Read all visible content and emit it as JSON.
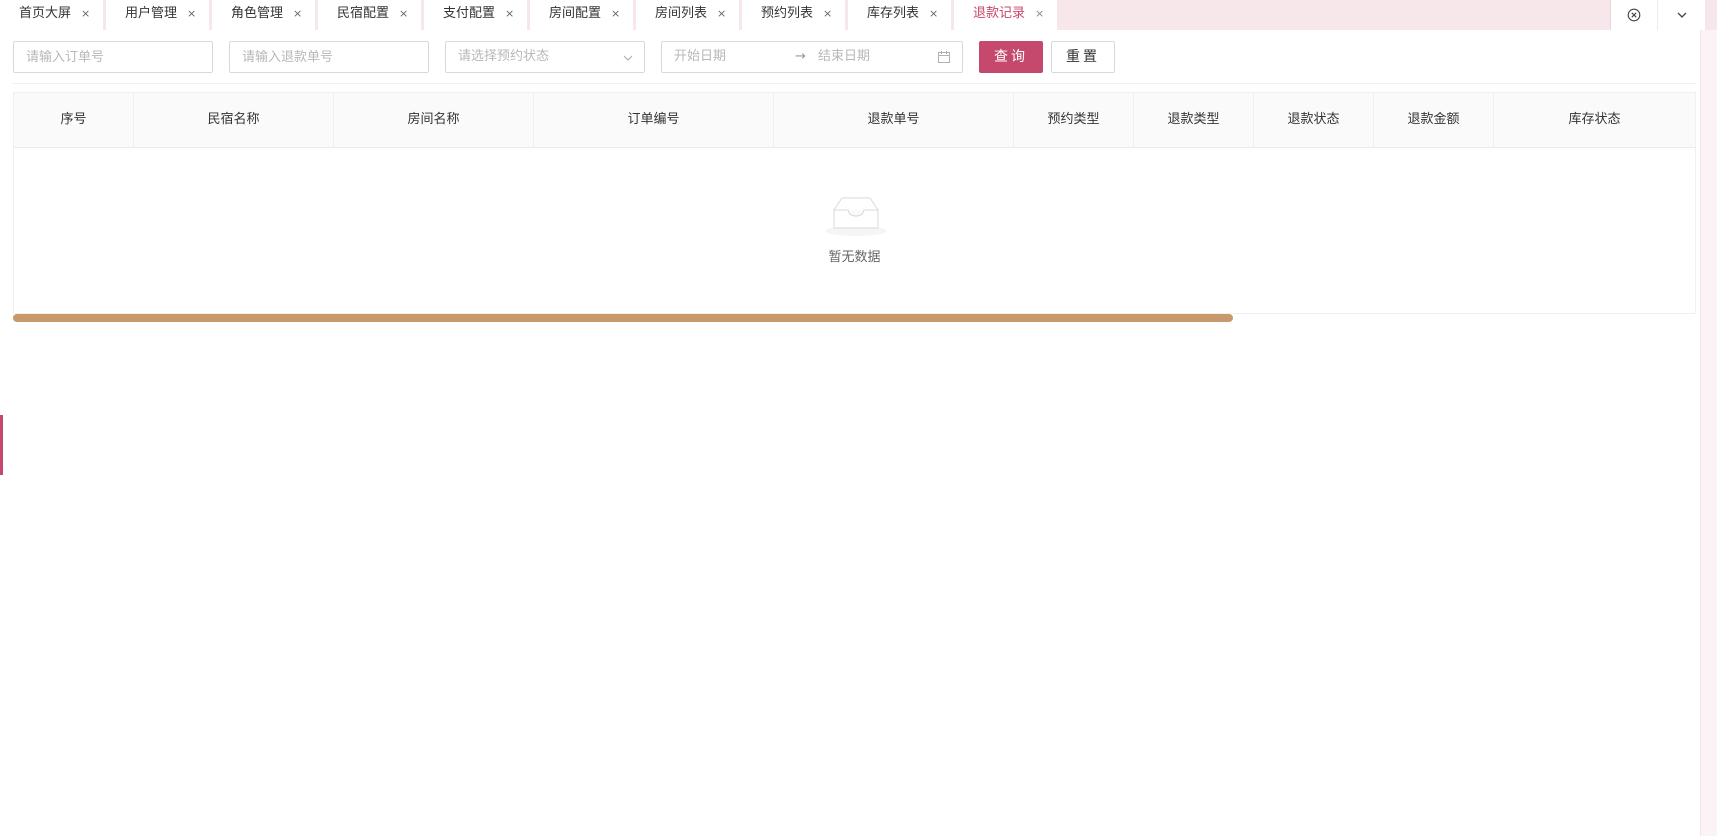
{
  "tabs": [
    {
      "label": "首页大屏",
      "active": false
    },
    {
      "label": "用户管理",
      "active": false
    },
    {
      "label": "角色管理",
      "active": false
    },
    {
      "label": "民宿配置",
      "active": false
    },
    {
      "label": "支付配置",
      "active": false
    },
    {
      "label": "房间配置",
      "active": false
    },
    {
      "label": "房间列表",
      "active": false
    },
    {
      "label": "预约列表",
      "active": false
    },
    {
      "label": "库存列表",
      "active": false
    },
    {
      "label": "退款记录",
      "active": true
    }
  ],
  "tab_close_glyph": "×",
  "tab_actions": {
    "close_all_icon": "close-circle-icon",
    "more_icon": "chevron-down-icon"
  },
  "filters": {
    "order_no_placeholder": "请输入订单号",
    "refund_no_placeholder": "请输入退款单号",
    "status_placeholder": "请选择预约状态",
    "start_date_placeholder": "开始日期",
    "end_date_placeholder": "结束日期",
    "range_separator": "→"
  },
  "buttons": {
    "query": "查询",
    "reset": "重置"
  },
  "table": {
    "columns": [
      "序号",
      "民宿名称",
      "房间名称",
      "订单编号",
      "退款单号",
      "预约类型",
      "退款类型",
      "退款状态",
      "退款金额",
      "库存状态"
    ],
    "rows": [],
    "empty_text": "暂无数据"
  },
  "colors": {
    "accent": "#c5496c",
    "tabbar_bg": "#f7e6ea",
    "scrollbar_thumb": "#c69a6b"
  }
}
